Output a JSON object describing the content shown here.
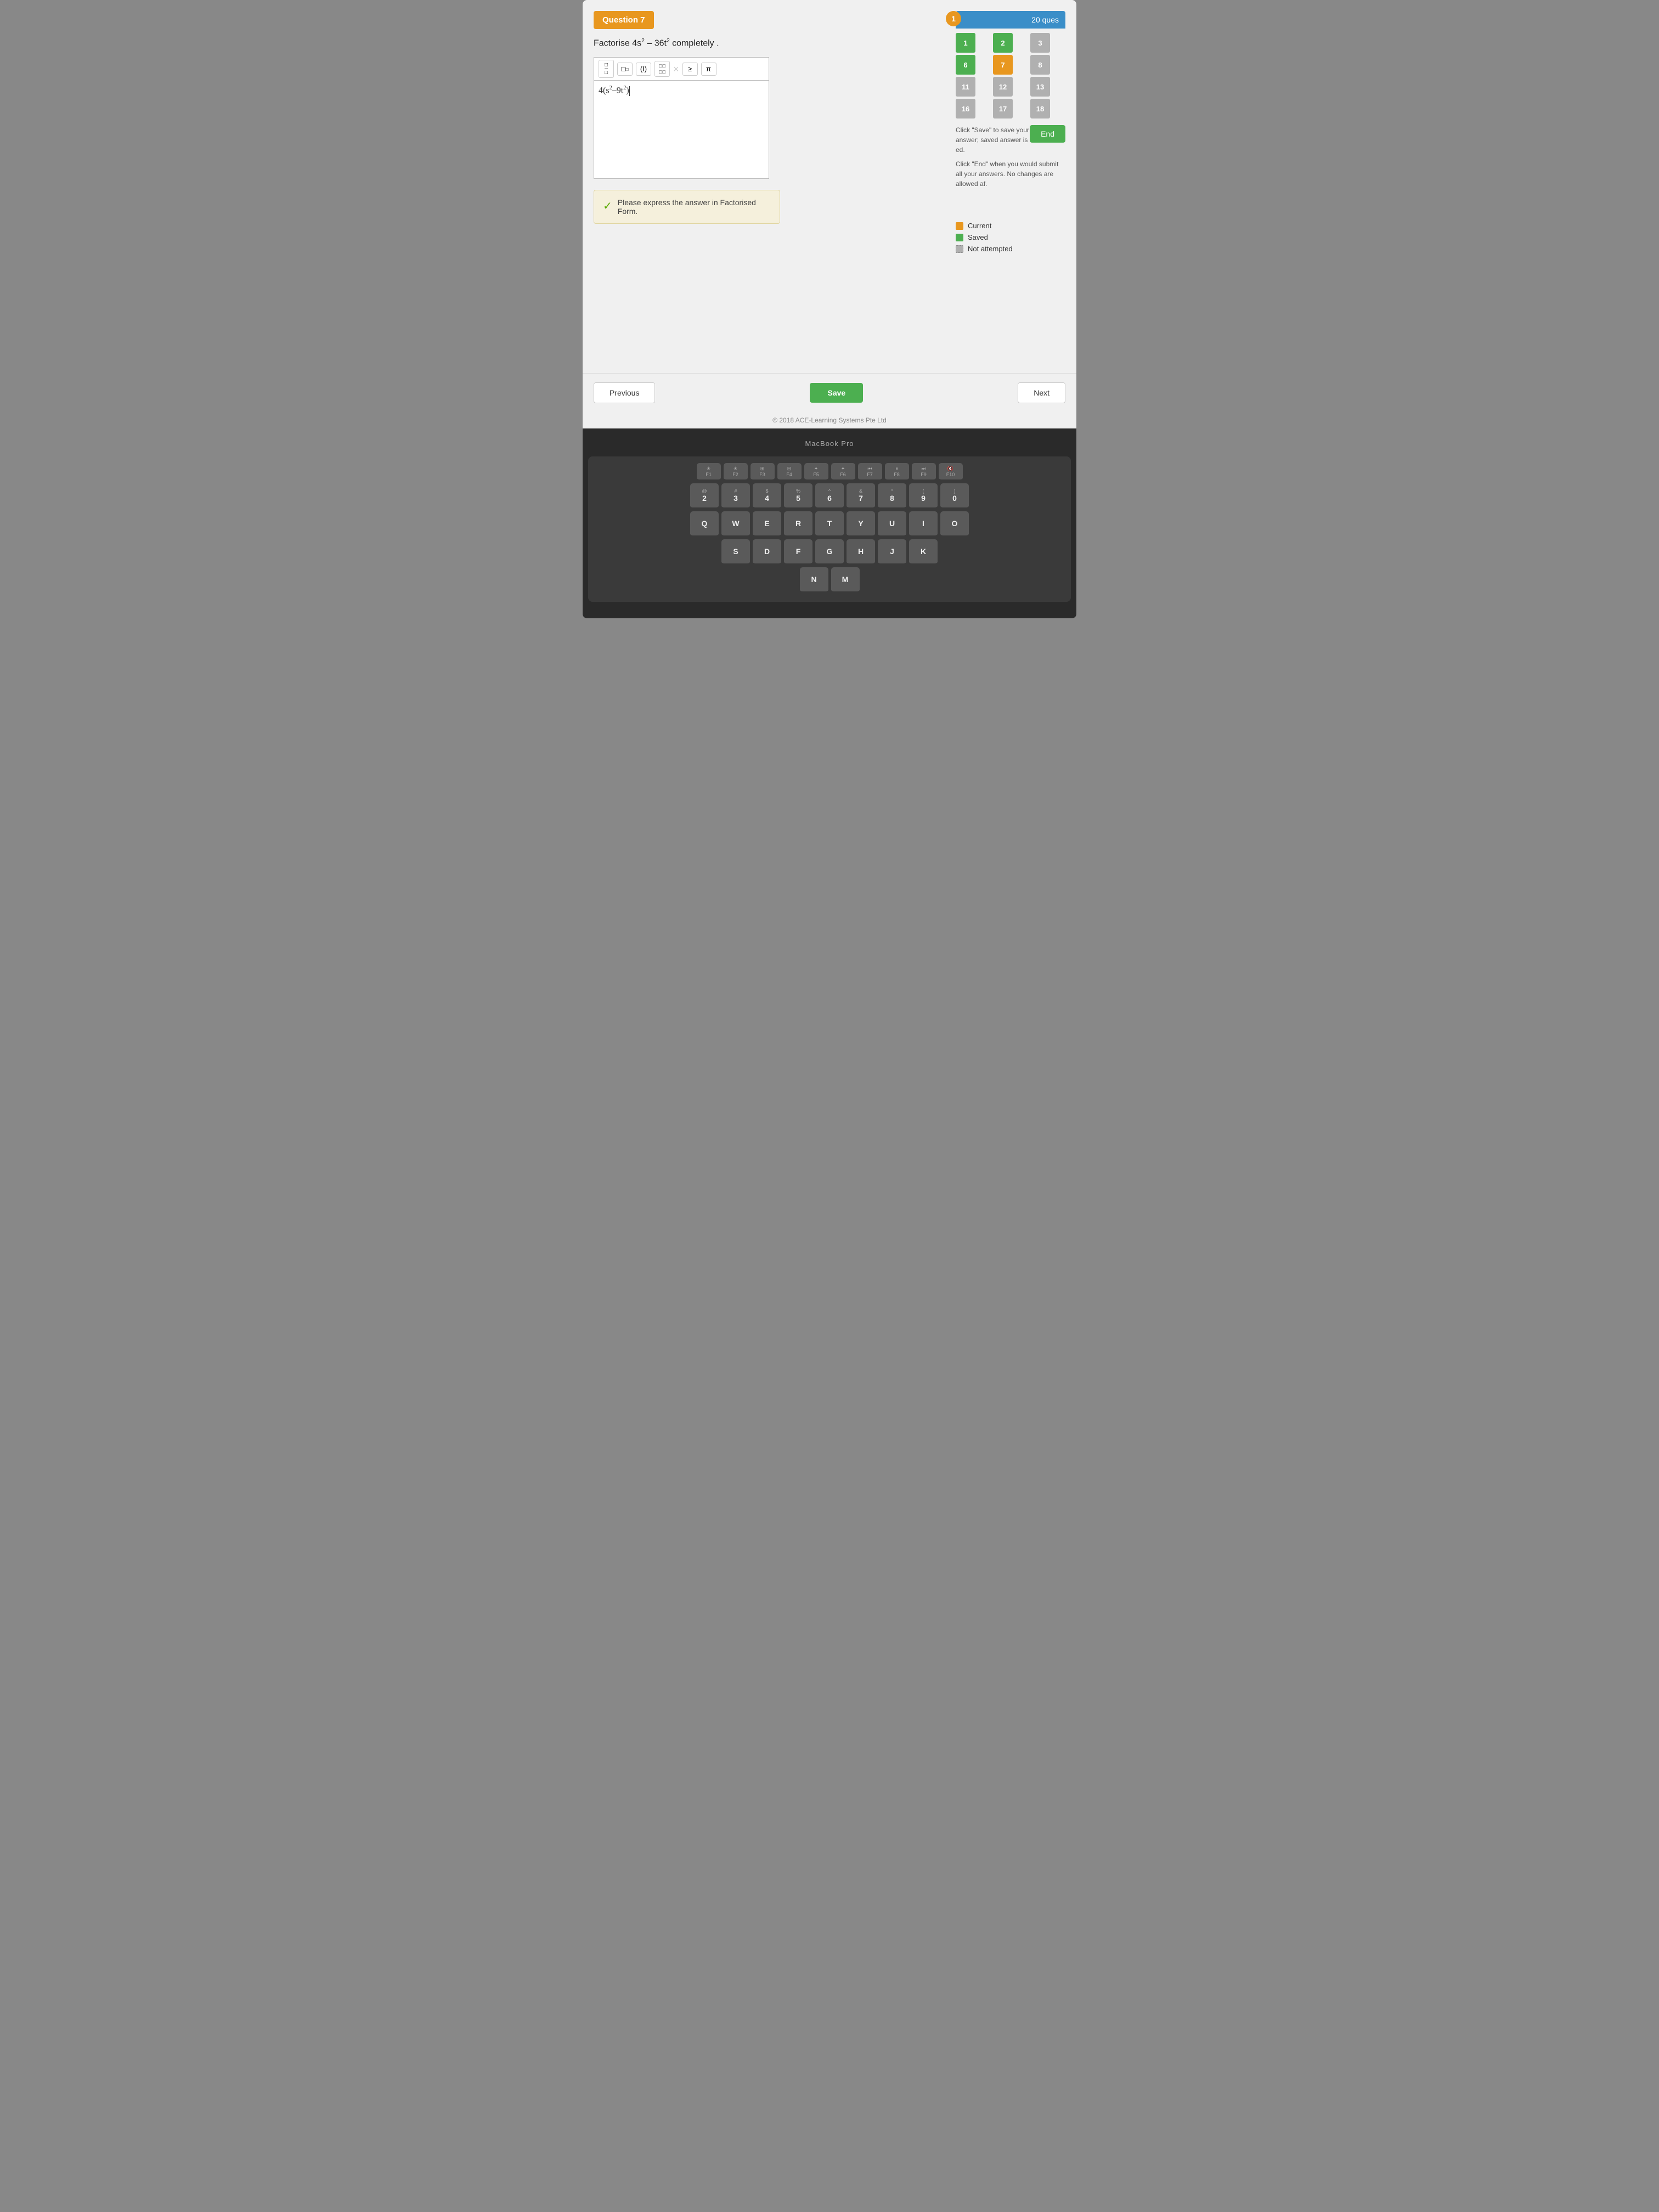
{
  "question": {
    "number": "Question 7",
    "badge_number": "1",
    "text": "Factorise 4s² – 36t² completely .",
    "input_value": "4(s²–9t²)"
  },
  "hint": {
    "icon": "✓",
    "text": "Please express the answer in Factorised Form."
  },
  "toolbar": {
    "buttons": [
      "½",
      "□",
      "(I)",
      "⊞",
      "×",
      "≥",
      "π"
    ]
  },
  "sidebar": {
    "header": "20 ques",
    "end_button": "End",
    "grid_cells": [
      {
        "number": "1",
        "state": "saved"
      },
      {
        "number": "2",
        "state": "saved"
      },
      {
        "number": "3",
        "state": "not-attempted"
      },
      {
        "number": "6",
        "state": "saved"
      },
      {
        "number": "7",
        "state": "current"
      },
      {
        "number": "8",
        "state": "not-attempted"
      },
      {
        "number": "11",
        "state": "not-attempted"
      },
      {
        "number": "12",
        "state": "not-attempted"
      },
      {
        "number": "13",
        "state": "not-attempted"
      },
      {
        "number": "16",
        "state": "not-attempted"
      },
      {
        "number": "17",
        "state": "not-attempted"
      },
      {
        "number": "18",
        "state": "not-attempted"
      }
    ],
    "legend": {
      "current_label": "Current",
      "saved_label": "Saved",
      "not_attempted_label": "Not attempted"
    },
    "instructions": [
      "Click \"Save\" to save your answer; saved answer is ed.",
      "Click \"End\" when you would submit all your answers. No changes are allowed af."
    ]
  },
  "navigation": {
    "previous_label": "Previous",
    "save_label": "Save",
    "next_label": "Next"
  },
  "copyright": "© 2018 ACE-Learning Systems Pte Ltd",
  "keyboard_label": "MacBook Pro"
}
